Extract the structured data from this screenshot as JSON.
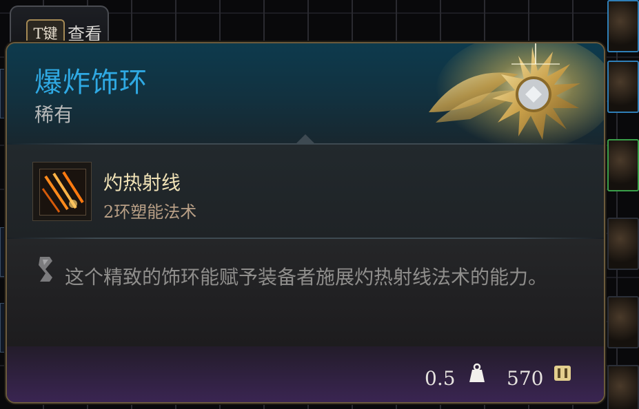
{
  "hint": {
    "key_label": "T键",
    "action_label": "查看"
  },
  "item": {
    "name": "爆炸饰环",
    "rarity": "稀有",
    "rarity_color": "#2fa9e3",
    "art_icon": "ornate-gold-circlet-icon"
  },
  "spell": {
    "name": "灼热射线",
    "level": "2环塑能法术",
    "icon": "scorching-ray-icon"
  },
  "description": {
    "icon": "quill-icon",
    "text": "这个精致的饰环能赋予装备者施展灼热射线法术的能力。"
  },
  "footer": {
    "weight": "0.5",
    "weight_icon": "weight-icon",
    "price": "570",
    "price_icon": "gold-coin-icon"
  }
}
